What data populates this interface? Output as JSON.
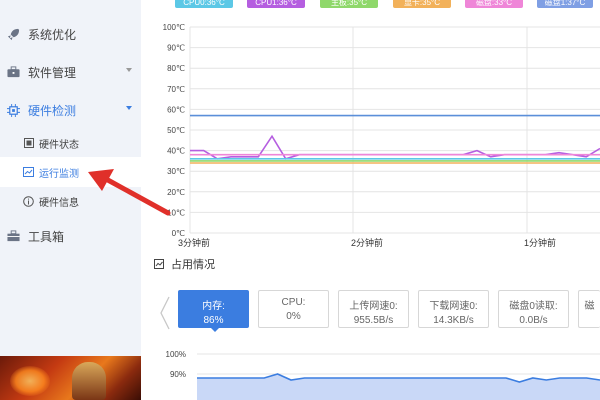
{
  "sidebar": {
    "items": [
      {
        "label": "系统优化",
        "icon": "rocket-icon"
      },
      {
        "label": "软件管理",
        "icon": "briefcase-icon"
      },
      {
        "label": "硬件检测",
        "icon": "chip-icon",
        "active": true
      }
    ],
    "subitems": [
      {
        "label": "硬件状态",
        "icon": "monitor-icon"
      },
      {
        "label": "运行监测",
        "icon": "line-chart-icon",
        "active": true
      },
      {
        "label": "硬件信息",
        "icon": "info-icon"
      }
    ],
    "toolbox": {
      "label": "工具箱",
      "icon": "toolbox-icon"
    }
  },
  "legend": [
    {
      "label": "CPU0:36°C",
      "color": "#5cc8e6"
    },
    {
      "label": "CPU1:36°C",
      "color": "#b55ee0"
    },
    {
      "label": "主板:35°C",
      "color": "#8fd86b"
    },
    {
      "label": "显卡:35°C",
      "color": "#f2b15a"
    },
    {
      "label": "磁盘:33°C",
      "color": "#ef86d8"
    },
    {
      "label": "磁盘1:37°C",
      "color": "#7f9fe4"
    }
  ],
  "chart_data": [
    {
      "type": "line",
      "y_ticks": [
        "100℃",
        "90℃",
        "80℃",
        "70℃",
        "60℃",
        "50℃",
        "40℃",
        "30℃",
        "20℃",
        "10℃",
        "0℃"
      ],
      "ylim": [
        0,
        100
      ],
      "x_tick_labels": [
        "3分钟前",
        "2分钟前",
        "1分钟前"
      ],
      "grid": true,
      "series": [
        {
          "color": "#5b8fd9",
          "values": [
            57,
            57,
            57,
            57,
            57,
            57,
            57,
            57,
            57,
            57,
            57,
            57,
            57,
            57,
            57,
            57,
            57,
            57,
            57,
            57,
            57,
            57,
            57,
            57,
            57,
            57,
            57,
            57,
            57,
            57,
            57
          ]
        },
        {
          "color": "#b55ee0",
          "values": [
            40,
            40,
            36,
            37,
            37,
            37,
            47,
            36,
            38,
            38,
            38,
            38,
            38,
            38,
            38,
            38,
            38,
            38,
            38,
            38,
            38,
            40,
            37,
            38,
            38,
            38,
            38,
            39,
            38,
            37,
            41
          ]
        },
        {
          "color": "#ef86d8",
          "values": [
            38,
            38,
            38,
            38,
            38,
            38,
            38,
            38,
            38,
            38,
            38,
            38,
            38,
            38,
            38,
            38,
            38,
            38,
            38,
            38,
            38,
            38,
            38,
            38,
            38,
            38,
            38,
            38,
            38,
            38,
            38
          ]
        },
        {
          "color": "#5cc8e6",
          "values": [
            36,
            36,
            36,
            36,
            36,
            36,
            36,
            36,
            36,
            36,
            36,
            36,
            36,
            36,
            36,
            36,
            36,
            36,
            36,
            36,
            36,
            36,
            36,
            36,
            36,
            36,
            36,
            36,
            36,
            36,
            36
          ]
        },
        {
          "color": "#8fd86b",
          "values": [
            35,
            35,
            35,
            35,
            35,
            35,
            35,
            35,
            35,
            35,
            35,
            35,
            35,
            35,
            35,
            35,
            35,
            35,
            35,
            35,
            35,
            35,
            35,
            35,
            35,
            35,
            35,
            35,
            35,
            35,
            35
          ]
        },
        {
          "color": "#f2b15a",
          "values": [
            34,
            34,
            34,
            34,
            34,
            34,
            34,
            34,
            34,
            34,
            34,
            34,
            34,
            34,
            34,
            34,
            34,
            34,
            34,
            34,
            34,
            34,
            34,
            34,
            34,
            34,
            34,
            34,
            34,
            34,
            34
          ]
        }
      ]
    },
    {
      "type": "area",
      "y_ticks": [
        "100%",
        "90%"
      ],
      "ylim": [
        80,
        100
      ],
      "grid": true,
      "series": [
        {
          "color": "#3b7de0",
          "values": [
            88,
            88,
            88,
            88,
            88,
            88,
            90,
            87,
            88,
            88,
            88,
            88,
            88,
            88,
            88,
            88,
            88,
            88,
            88,
            88,
            88,
            88,
            88,
            88,
            86,
            88,
            87,
            88,
            88,
            88,
            87
          ]
        }
      ]
    }
  ],
  "usage": {
    "title": "占用情况",
    "cards": [
      {
        "label": "内存:",
        "value": "86%",
        "active": true
      },
      {
        "label": "CPU:",
        "value": "0%"
      },
      {
        "label": "上传网速0:",
        "value": "955.5B/s"
      },
      {
        "label": "下载网速0:",
        "value": "14.3KB/s"
      },
      {
        "label": "磁盘0读取:",
        "value": "0.0B/s"
      },
      {
        "label": "磁",
        "value": ""
      }
    ]
  }
}
